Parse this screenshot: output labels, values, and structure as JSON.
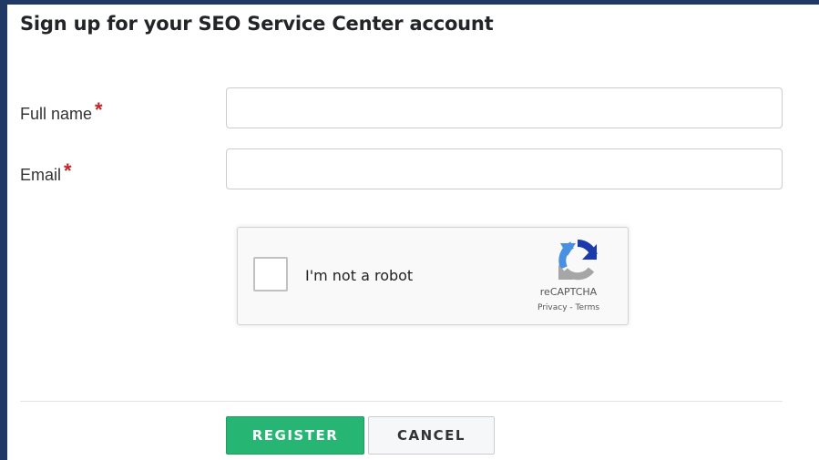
{
  "form": {
    "title": "Sign up for your SEO Service Center account",
    "required_marker": "*",
    "full_name": {
      "label": "Full name",
      "value": "",
      "placeholder": ""
    },
    "email": {
      "label": "Email",
      "value": "",
      "placeholder": ""
    }
  },
  "recaptcha": {
    "label": "I'm not a robot",
    "checked": false,
    "brand": "reCAPTCHA",
    "privacy_link": "Privacy",
    "separator": " - ",
    "terms_link": "Terms",
    "logo_icon": "recaptcha-logo-icon",
    "colors": {
      "blue": "#1c3aa9",
      "light_blue": "#4a90e2",
      "gray": "#a6a6a6"
    }
  },
  "actions": {
    "register_label": "REGISTER",
    "cancel_label": "CANCEL"
  },
  "colors": {
    "frame_border": "#1f3864",
    "required": "#c62127",
    "register_button": "#27b574"
  }
}
